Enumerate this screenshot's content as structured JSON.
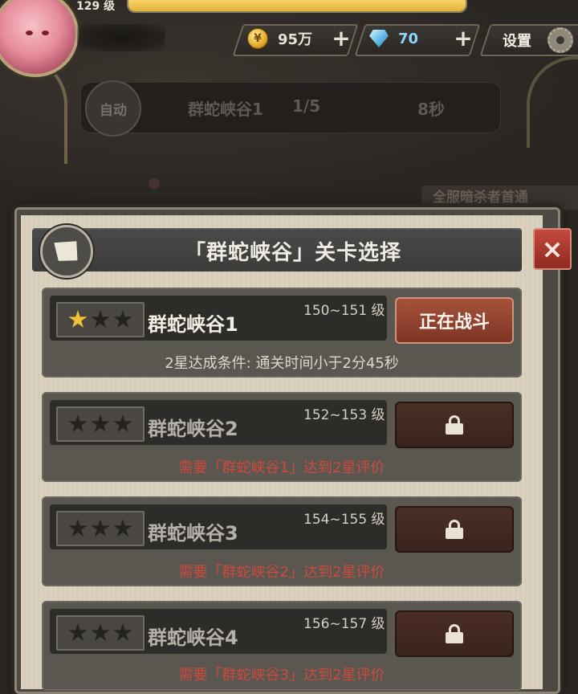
{
  "hud": {
    "level": "129 级",
    "exp_fraction": 1.0,
    "gold": {
      "icon": "coin-icon",
      "value": "95万"
    },
    "gems": {
      "icon": "gem-icon",
      "value": "70"
    },
    "plus": "+",
    "settings_label": "设置"
  },
  "auto_battle": {
    "button_label": "自动",
    "stage": "群蛇峡谷1",
    "progress": "1/5",
    "time": "8秒"
  },
  "background_notice": "全服暗杀者首通",
  "dialog": {
    "title": "「群蛇峡谷」关卡选择",
    "close_label": "×",
    "stages": [
      {
        "name": "群蛇峡谷1",
        "level_range": "150~151 级",
        "stars": 1,
        "button": "正在战斗",
        "state": "active",
        "condition": "2星达成条件:  通关时间小于2分45秒"
      },
      {
        "name": "群蛇峡谷2",
        "level_range": "152~153 级",
        "stars": 0,
        "button": "",
        "state": "locked",
        "condition": "需要「群蛇峡谷1」达到2星评价"
      },
      {
        "name": "群蛇峡谷3",
        "level_range": "154~155 级",
        "stars": 0,
        "button": "",
        "state": "locked",
        "condition": "需要「群蛇峡谷2」达到2星评价"
      },
      {
        "name": "群蛇峡谷4",
        "level_range": "156~157 级",
        "stars": 0,
        "button": "",
        "state": "locked",
        "condition": "需要「群蛇峡谷3」达到2星评价"
      }
    ]
  },
  "colors": {
    "exp_fill": "#f2c94c",
    "active_button": "#9a4a33",
    "requirement_text": "#cf4a3c",
    "star_on": "#f0c23a"
  }
}
